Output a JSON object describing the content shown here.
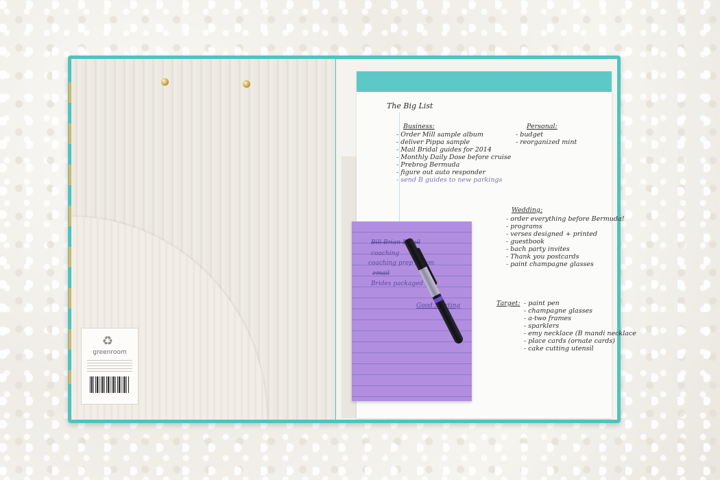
{
  "label": {
    "brand": "greenroom"
  },
  "list": {
    "title": "The Big List",
    "business": {
      "heading": "Business:",
      "items": [
        "Order Mill sample album",
        "deliver Pippa sample",
        "Mail Bridal guides for 2014",
        "Monthly Daily Dose before cruise",
        "Prebrog Bermuda",
        "figure out auto responder",
        "send B guides to new parkings"
      ]
    },
    "personal": {
      "heading": "Personal:",
      "items": [
        "budget",
        "reorganized mint"
      ]
    },
    "wedding": {
      "heading": "Wedding:",
      "items": [
        "order everything before Bermuda!",
        "programs",
        "verses designed + printed",
        "guestbook",
        "bach party invites",
        "Thank you postcards",
        "paint champagne glasses"
      ]
    },
    "target": {
      "heading": "Target:",
      "items": [
        "paint pen",
        "champagne glasses",
        "a-two frames",
        "sparklers",
        "emy necklace (B mandi necklace",
        "place cards (ornate cards)",
        "cake cutting utensil"
      ]
    }
  },
  "sticky": {
    "items": [
      "Bill Brian Email",
      "coaching",
      "coaching prep action",
      "email",
      "Brides packaged",
      "Good Starting"
    ]
  }
}
